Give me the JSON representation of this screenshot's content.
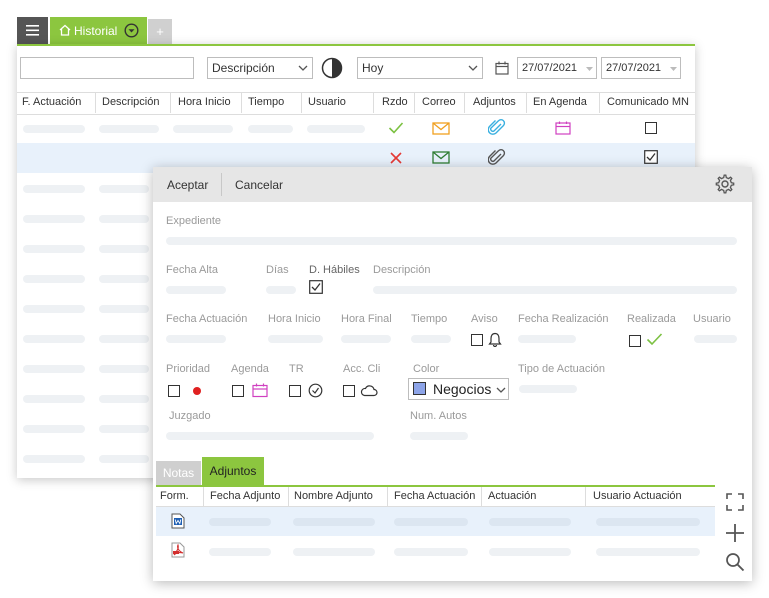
{
  "tabs": {
    "menu_icon": "hamburger-icon",
    "active_tab": "Historial",
    "add_tab": "+"
  },
  "filters": {
    "search_value": "",
    "field_select": "Descripción",
    "period_select": "Hoy",
    "date_from": "27/07/2021",
    "date_to": "27/07/2021"
  },
  "grid": {
    "columns": [
      "F. Actuación",
      "Descripción",
      "Hora Inicio",
      "Tiempo",
      "Usuario",
      "Rzdo",
      "Correo",
      "Adjuntos",
      "En Agenda",
      "Comunicado MN"
    ]
  },
  "dialog": {
    "accept_label": "Aceptar",
    "cancel_label": "Cancelar",
    "labels": {
      "expediente": "Expediente",
      "fecha_alta": "Fecha Alta",
      "dias": "Días",
      "d_habiles": "D. Hábiles",
      "descripcion": "Descripción",
      "fecha_actuacion": "Fecha Actuación",
      "hora_inicio": "Hora Inicio",
      "hora_final": "Hora Final",
      "tiempo": "Tiempo",
      "aviso": "Aviso",
      "fecha_realizacion": "Fecha Realización",
      "realizada": "Realizada",
      "usuario": "Usuario",
      "prioridad": "Prioridad",
      "agenda": "Agenda",
      "tr": "TR",
      "acc_cli": "Acc. Cli",
      "color": "Color",
      "tipo_actuacion": "Tipo de Actuación",
      "juzgado": "Juzgado",
      "num_autos": "Num. Autos"
    },
    "color_value": "Negocios",
    "color_swatch": "#8da4e8",
    "tabs": [
      "Notas",
      "Adjuntos"
    ],
    "attach_columns": [
      "Form.",
      "Fecha Adjunto",
      "Nombre Adjunto",
      "Fecha Actuación",
      "Actuación",
      "Usuario Actuación"
    ]
  },
  "colors": {
    "accent": "#8cc63f",
    "selected_row": "#e8f1fb",
    "check_green": "#7cc142",
    "cross_red": "#e53935",
    "mail_orange": "#f0a020",
    "clip_blue": "#3ab0e0",
    "agenda_pink": "#d040c0",
    "priority_red": "#e02020"
  }
}
